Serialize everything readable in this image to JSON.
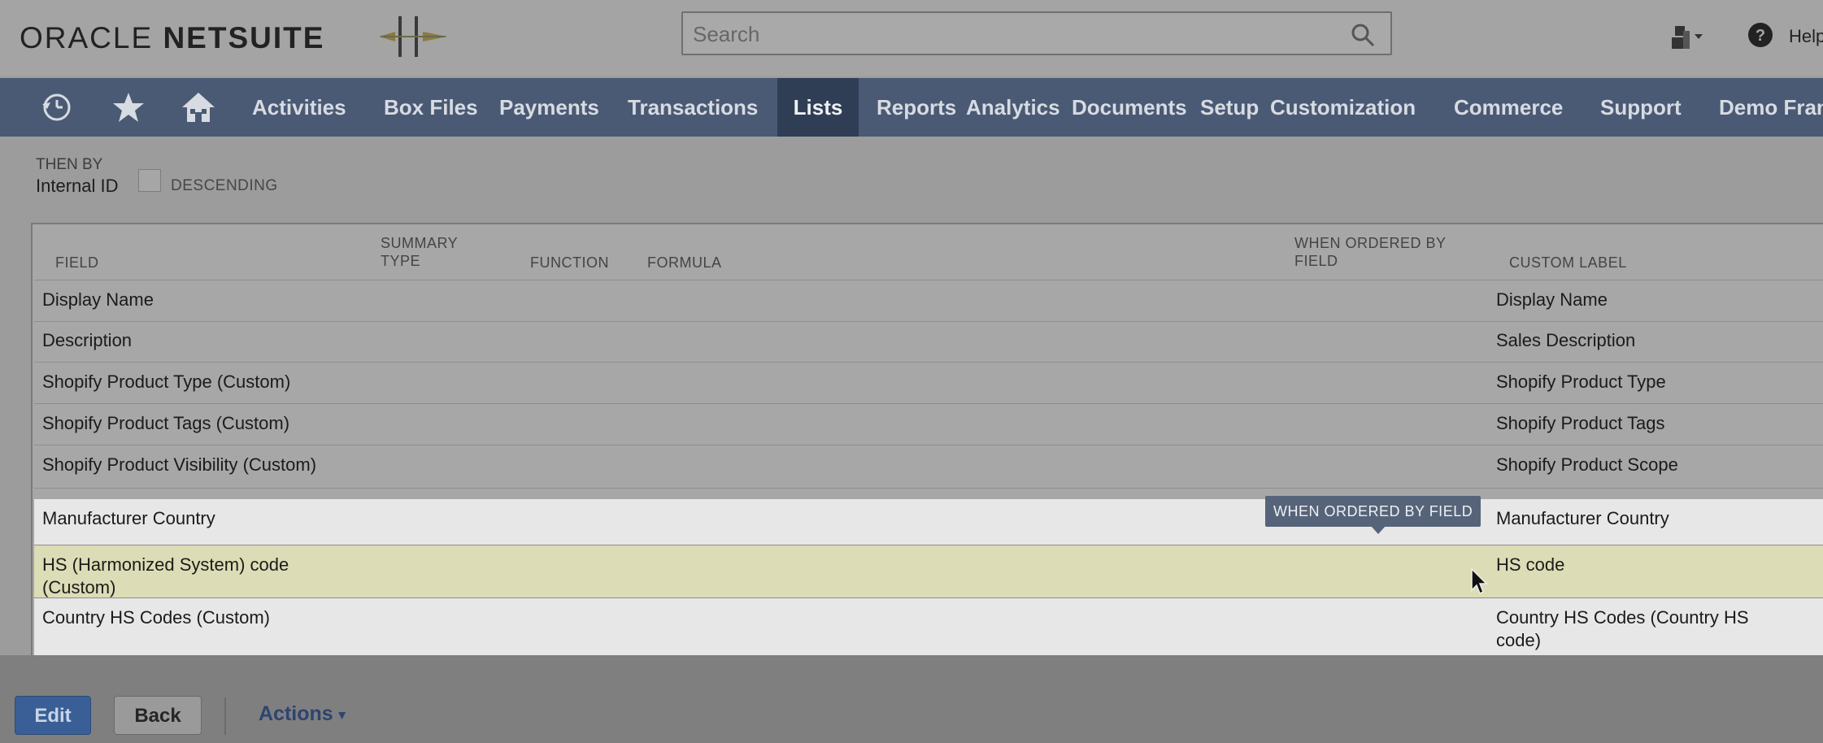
{
  "header": {
    "logo_oracle": "ORACLE",
    "logo_netsuite": "NETSUITE",
    "search_placeholder": "Search",
    "help_label": "Help"
  },
  "nav": {
    "items": [
      {
        "label": "Activities"
      },
      {
        "label": "Box Files"
      },
      {
        "label": "Payments"
      },
      {
        "label": "Transactions"
      },
      {
        "label": "Lists"
      },
      {
        "label": "Reports"
      },
      {
        "label": "Analytics"
      },
      {
        "label": "Documents"
      },
      {
        "label": "Setup"
      },
      {
        "label": "Customization"
      },
      {
        "label": "Commerce"
      },
      {
        "label": "Support"
      },
      {
        "label": "Demo Fran"
      }
    ],
    "active": "Lists",
    "icons": [
      "recent-records-icon",
      "star-icon",
      "home-icon"
    ]
  },
  "sort": {
    "then_by": "THEN BY",
    "field": "Internal ID",
    "descending": "DESCENDING"
  },
  "table": {
    "headers": {
      "field": "FIELD",
      "summary_type_1": "SUMMARY",
      "summary_type_2": "TYPE",
      "function": "FUNCTION",
      "formula": "FORMULA",
      "when_ordered_1": "WHEN ORDERED BY",
      "when_ordered_2": "FIELD",
      "custom_label": "CUSTOM LABEL"
    },
    "rows": [
      {
        "field": "Display Name",
        "label": "Display Name"
      },
      {
        "field": "Description",
        "label": "Sales Description"
      },
      {
        "field": "Shopify Product Type (Custom)",
        "label": "Shopify Product Type"
      },
      {
        "field": "Shopify Product Tags (Custom)",
        "label": "Shopify Product Tags"
      },
      {
        "field": "Shopify Product Visibility (Custom)",
        "label": "Shopify Product Scope"
      },
      {
        "field": "Manufacturer Country",
        "label": "Manufacturer Country"
      },
      {
        "field": "HS (Harmonized System) code (Custom)",
        "label": "HS code"
      },
      {
        "field": "Country HS Codes (Custom)",
        "label": "Country HS Codes (Country HS code)"
      }
    ]
  },
  "tooltip": "WHEN ORDERED BY FIELD",
  "buttons": {
    "edit": "Edit",
    "back": "Back",
    "actions": "Actions"
  },
  "colors": {
    "nav_bg": "#4a5a74",
    "nav_active": "#2f3d55",
    "edit_button": "#3a5f96",
    "highlight_row": "#dcdcb6"
  }
}
